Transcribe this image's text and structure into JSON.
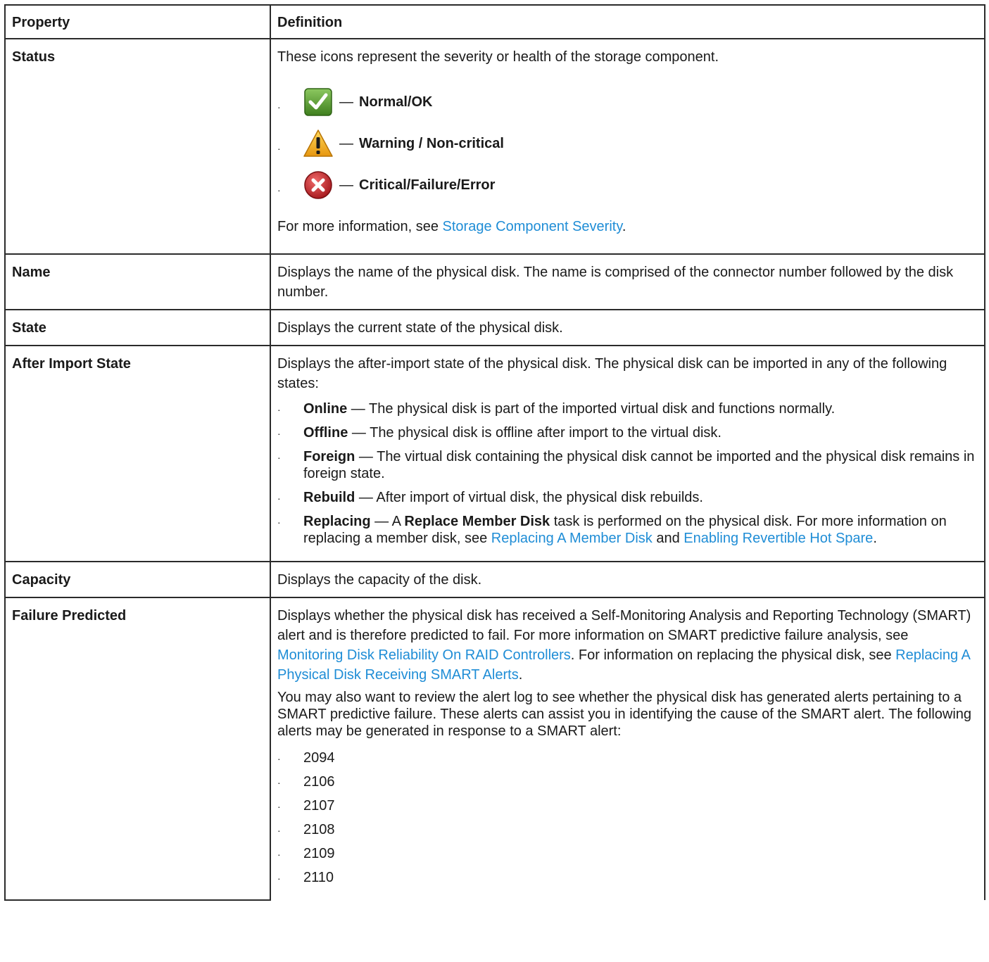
{
  "header": {
    "property": "Property",
    "definition": "Definition"
  },
  "status": {
    "label": "Status",
    "intro": "These icons represent the severity or health of the storage component.",
    "icons": [
      {
        "icon": "ok-check-icon",
        "dash": "—",
        "label": "Normal/OK",
        "color": "#5a9e2f"
      },
      {
        "icon": "warning-triangle-icon",
        "dash": "—",
        "label": "Warning / Non-critical",
        "color": "#f2b81d"
      },
      {
        "icon": "critical-x-icon",
        "dash": "—",
        "label": "Critical/Failure/Error",
        "color": "#c0282d"
      }
    ],
    "more_prefix": "For more information, see ",
    "more_link": "Storage Component Severity",
    "more_suffix": "."
  },
  "name": {
    "label": "Name",
    "text": "Displays the name of the physical disk. The name is comprised of the connector number followed by the disk number."
  },
  "state": {
    "label": "State",
    "text": "Displays the current state of the physical disk."
  },
  "after_import": {
    "label": "After Import State",
    "intro": "Displays the after-import state of the physical disk. The physical disk can be imported in any of the following states:",
    "items": [
      {
        "term": "Online",
        "text": " — The physical disk is part of the imported virtual disk and functions normally."
      },
      {
        "term": "Offline",
        "text": " — The physical disk is offline after import to the virtual disk."
      },
      {
        "term": "Foreign",
        "text": " — The virtual disk containing the physical disk cannot be imported and the physical disk remains in foreign state."
      },
      {
        "term": "Rebuild",
        "text": " — After import of virtual disk, the physical disk rebuilds."
      }
    ],
    "replacing": {
      "term": "Replacing",
      "pre": " — A ",
      "task": "Replace Member Disk",
      "mid": " task is performed on the physical disk. For more information on replacing a member disk, see ",
      "link1": "Replacing A Member Disk",
      "and": " and ",
      "link2": "Enabling Revertible Hot Spare",
      "end": "."
    }
  },
  "capacity": {
    "label": "Capacity",
    "text": "Displays the capacity of the disk."
  },
  "failure": {
    "label": "Failure Predicted",
    "p1_a": "Displays whether the physical disk has received a Self-Monitoring Analysis and Reporting Technology (SMART) alert and is therefore predicted to fail. For more information on SMART predictive failure analysis, see ",
    "p1_link1": "Monitoring Disk Reliability On RAID Controllers",
    "p1_b": ". For information on replacing the physical disk, see ",
    "p1_link2": "Replacing A Physical Disk Receiving SMART Alerts",
    "p1_c": ".",
    "p2": "You may also want to review the alert log to see whether the physical disk has generated alerts pertaining to a SMART predictive failure. These alerts can assist you in identifying the cause of the SMART alert. The following alerts may be generated in response to a SMART alert:",
    "alerts": [
      "2094",
      "2106",
      "2107",
      "2108",
      "2109",
      "2110"
    ]
  },
  "bullet": "·"
}
